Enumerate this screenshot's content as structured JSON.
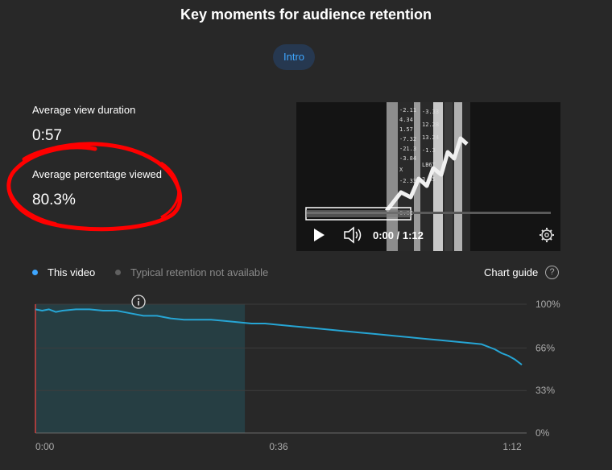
{
  "header": {
    "title": "Key moments for audience retention"
  },
  "chip": {
    "label": "Intro"
  },
  "stats": {
    "avg_view_duration_label": "Average view duration",
    "avg_view_duration_value": "0:57",
    "avg_pct_viewed_label": "Average percentage viewed",
    "avg_pct_viewed_value": "80.3%"
  },
  "player": {
    "time": "0:00 / 1:12",
    "progress": 0.0
  },
  "legend": {
    "this_video": "This video",
    "typical": "Typical retention not available",
    "this_video_color": "#3ea6ff",
    "typical_color": "#606060"
  },
  "chart_guide": {
    "label": "Chart guide",
    "help": "?"
  },
  "chart_data": {
    "type": "line",
    "x_tick_labels": [
      "0:00",
      "0:36",
      "1:12"
    ],
    "y_tick_labels": [
      "100%",
      "66%",
      "33%",
      "0%"
    ],
    "ylim": [
      0,
      100
    ],
    "xlim": [
      0,
      72
    ],
    "highlight_range": [
      0,
      31
    ],
    "series": [
      {
        "name": "This video",
        "color": "#26a5d4",
        "x": [
          0,
          1,
          2,
          3,
          4,
          6,
          8,
          10,
          12,
          14,
          16,
          18,
          20,
          22,
          24,
          26,
          28,
          30,
          32,
          34,
          36,
          38,
          40,
          42,
          44,
          46,
          48,
          50,
          52,
          54,
          56,
          58,
          60,
          62,
          64,
          66,
          67,
          68,
          69,
          70,
          71,
          72
        ],
        "y": [
          96,
          95,
          96,
          94,
          95,
          96,
          96,
          95,
          95,
          93,
          91,
          91,
          89,
          88,
          88,
          88,
          87,
          86,
          85,
          85,
          84,
          83,
          82,
          81,
          80,
          79,
          78,
          77,
          76,
          75,
          74,
          73,
          72,
          71,
          70,
          69,
          67,
          65,
          62,
          60,
          57,
          53
        ]
      }
    ]
  }
}
